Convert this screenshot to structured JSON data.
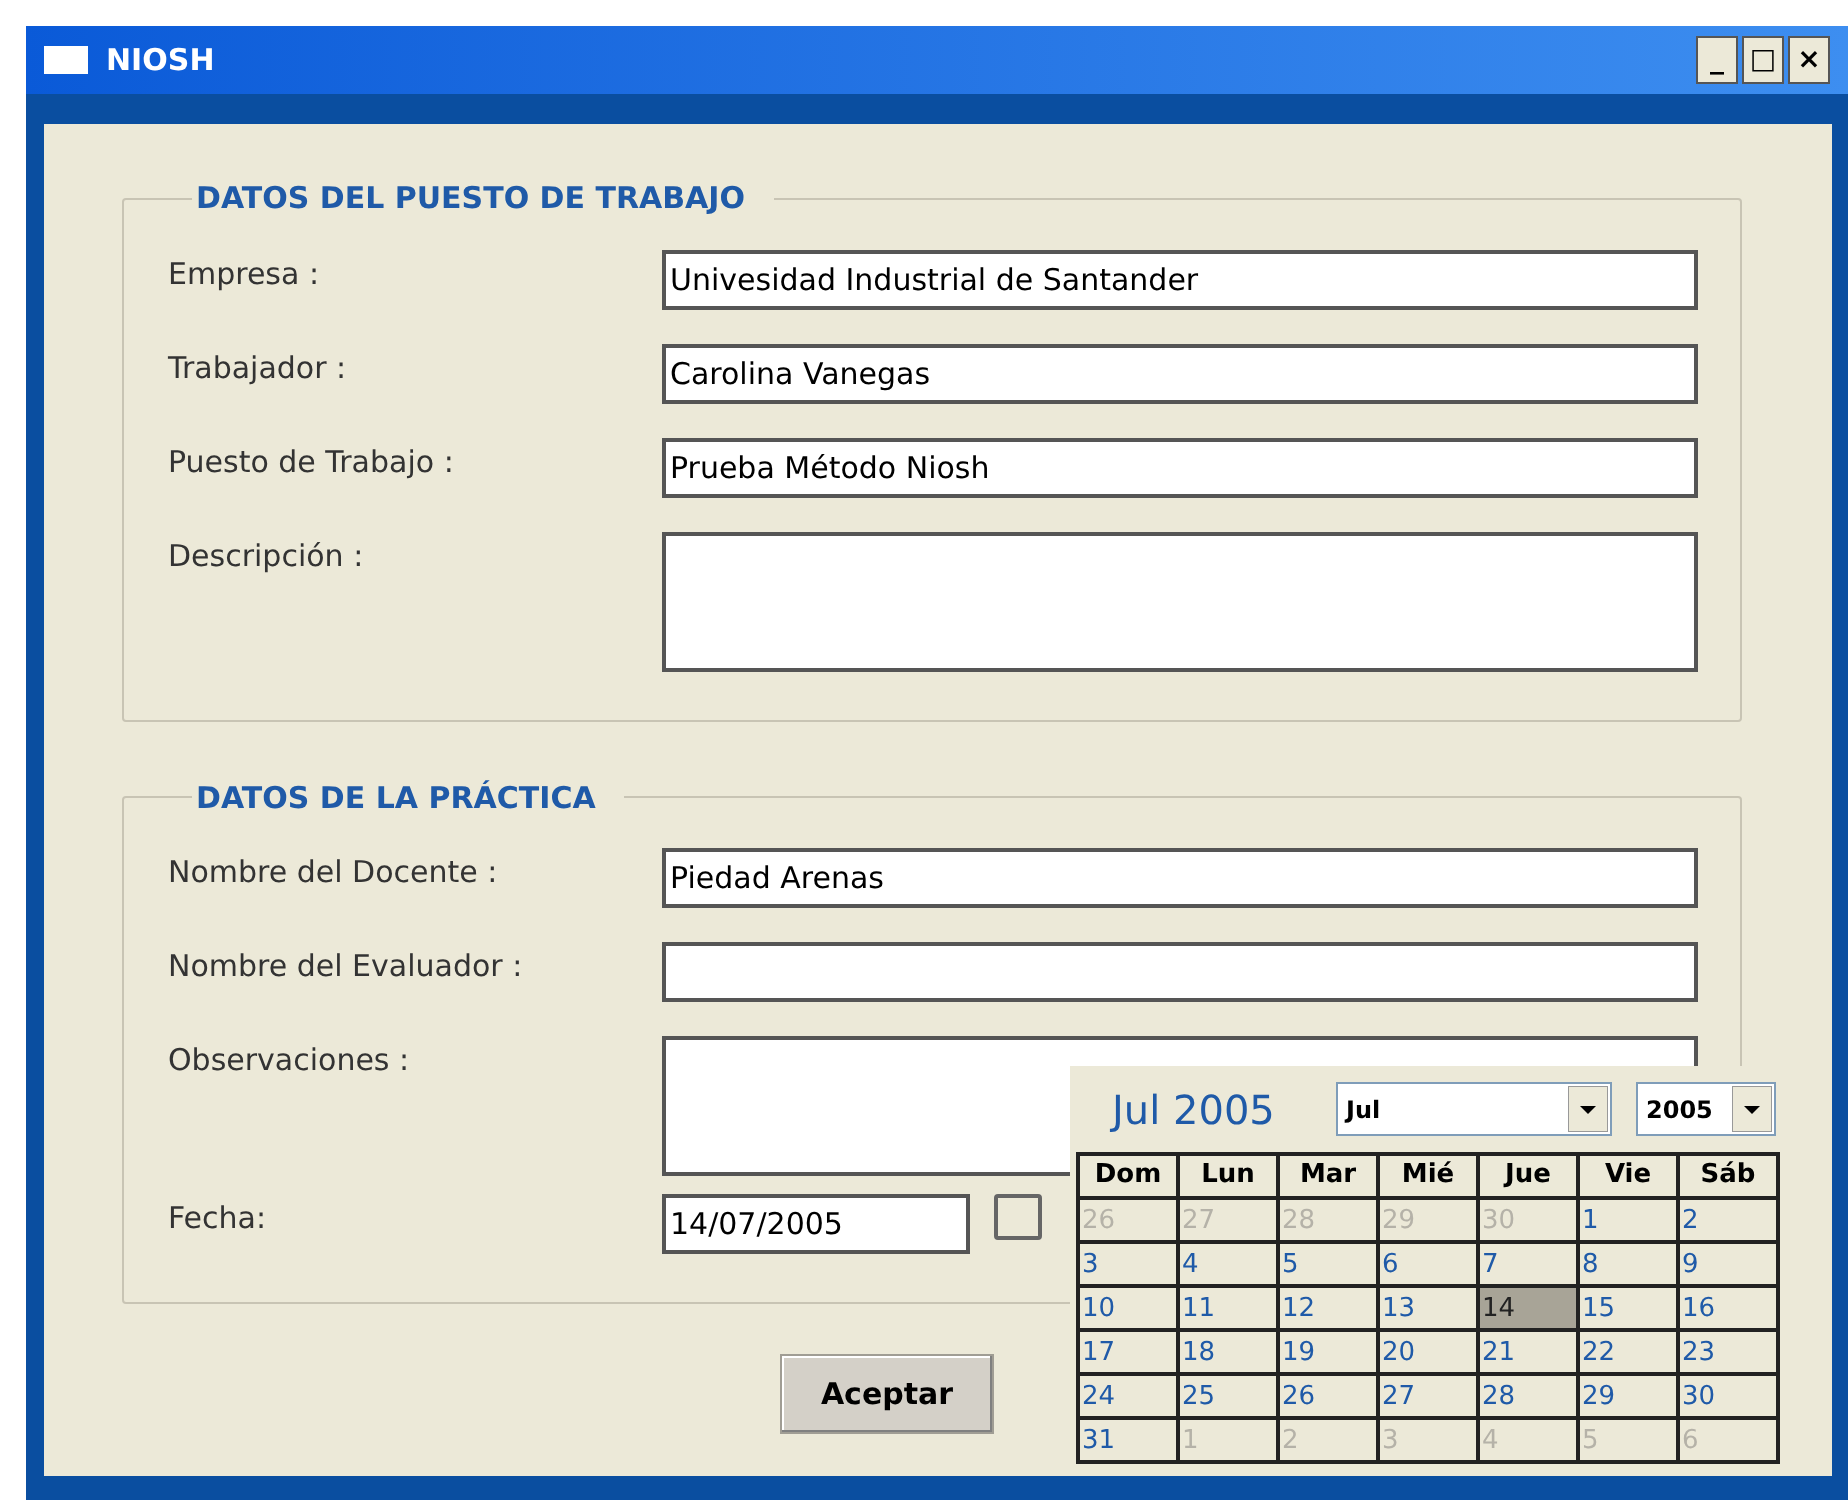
{
  "window": {
    "title": "NIOSH",
    "controls": [
      "_",
      "□",
      "×"
    ]
  },
  "sections": [
    {
      "title": "DATOS DEL PUESTO DE TRABAJO",
      "fields": [
        {
          "kind": "text",
          "label": "Empresa :",
          "value": "Univesidad Industrial de Santander"
        },
        {
          "kind": "text",
          "label": "Trabajador :",
          "value": "Carolina Vanegas"
        },
        {
          "kind": "text",
          "label": "Puesto de Trabajo :",
          "value": "Prueba Método Niosh"
        },
        {
          "kind": "multiline",
          "label": "Descripción :"
        }
      ]
    },
    {
      "title": "DATOS DE LA PRÁCTICA",
      "fields": [
        {
          "kind": "text",
          "label": "Nombre del Docente :",
          "value": "Piedad Arenas"
        },
        {
          "kind": "text",
          "label": "Nombre del Evaluador :"
        },
        {
          "kind": "multiline",
          "label": "Observaciones :"
        },
        {
          "kind": "date",
          "label": "Fecha:",
          "value": "14/07/2005"
        }
      ]
    }
  ],
  "accept_button": "Aceptar",
  "calendar": {
    "title": "Jul 2005",
    "month": "Jul",
    "year": "2005",
    "weekdays": [
      "Dom",
      "Lun",
      "Mar",
      "Mié",
      "Jue",
      "Vie",
      "Sáb"
    ],
    "days": [
      {
        "label": "26",
        "in_month": false,
        "selected": false
      },
      {
        "label": "27",
        "in_month": false,
        "selected": false
      },
      {
        "label": "28",
        "in_month": false,
        "selected": false
      },
      {
        "label": "29",
        "in_month": false,
        "selected": false
      },
      {
        "label": "30",
        "in_month": false,
        "selected": false
      },
      {
        "label": "1",
        "in_month": true,
        "selected": false
      },
      {
        "label": "2",
        "in_month": true,
        "selected": false
      },
      {
        "label": "3",
        "in_month": true,
        "selected": false
      },
      {
        "label": "4",
        "in_month": true,
        "selected": false
      },
      {
        "label": "5",
        "in_month": true,
        "selected": false
      },
      {
        "label": "6",
        "in_month": true,
        "selected": false
      },
      {
        "label": "7",
        "in_month": true,
        "selected": false
      },
      {
        "label": "8",
        "in_month": true,
        "selected": false
      },
      {
        "label": "9",
        "in_month": true,
        "selected": false
      },
      {
        "label": "10",
        "in_month": true,
        "selected": false
      },
      {
        "label": "11",
        "in_month": true,
        "selected": false
      },
      {
        "label": "12",
        "in_month": true,
        "selected": false
      },
      {
        "label": "13",
        "in_month": true,
        "selected": false
      },
      {
        "label": "14",
        "in_month": true,
        "selected": true
      },
      {
        "label": "15",
        "in_month": true,
        "selected": false
      },
      {
        "label": "16",
        "in_month": true,
        "selected": false
      },
      {
        "label": "17",
        "in_month": true,
        "selected": false
      },
      {
        "label": "18",
        "in_month": true,
        "selected": false
      },
      {
        "label": "19",
        "in_month": true,
        "selected": false
      },
      {
        "label": "20",
        "in_month": true,
        "selected": false
      },
      {
        "label": "21",
        "in_month": true,
        "selected": false
      },
      {
        "label": "22",
        "in_month": true,
        "selected": false
      },
      {
        "label": "23",
        "in_month": true,
        "selected": false
      },
      {
        "label": "24",
        "in_month": true,
        "selected": false
      },
      {
        "label": "25",
        "in_month": true,
        "selected": false
      },
      {
        "label": "26",
        "in_month": true,
        "selected": false
      },
      {
        "label": "27",
        "in_month": true,
        "selected": false
      },
      {
        "label": "28",
        "in_month": true,
        "selected": false
      },
      {
        "label": "29",
        "in_month": true,
        "selected": false
      },
      {
        "label": "30",
        "in_month": true,
        "selected": false
      },
      {
        "label": "31",
        "in_month": true,
        "selected": false
      },
      {
        "label": "1",
        "in_month": false,
        "selected": false
      },
      {
        "label": "2",
        "in_month": false,
        "selected": false
      },
      {
        "label": "3",
        "in_month": false,
        "selected": false
      },
      {
        "label": "4",
        "in_month": false,
        "selected": false
      },
      {
        "label": "5",
        "in_month": false,
        "selected": false
      },
      {
        "label": "6",
        "in_month": false,
        "selected": false
      }
    ]
  }
}
